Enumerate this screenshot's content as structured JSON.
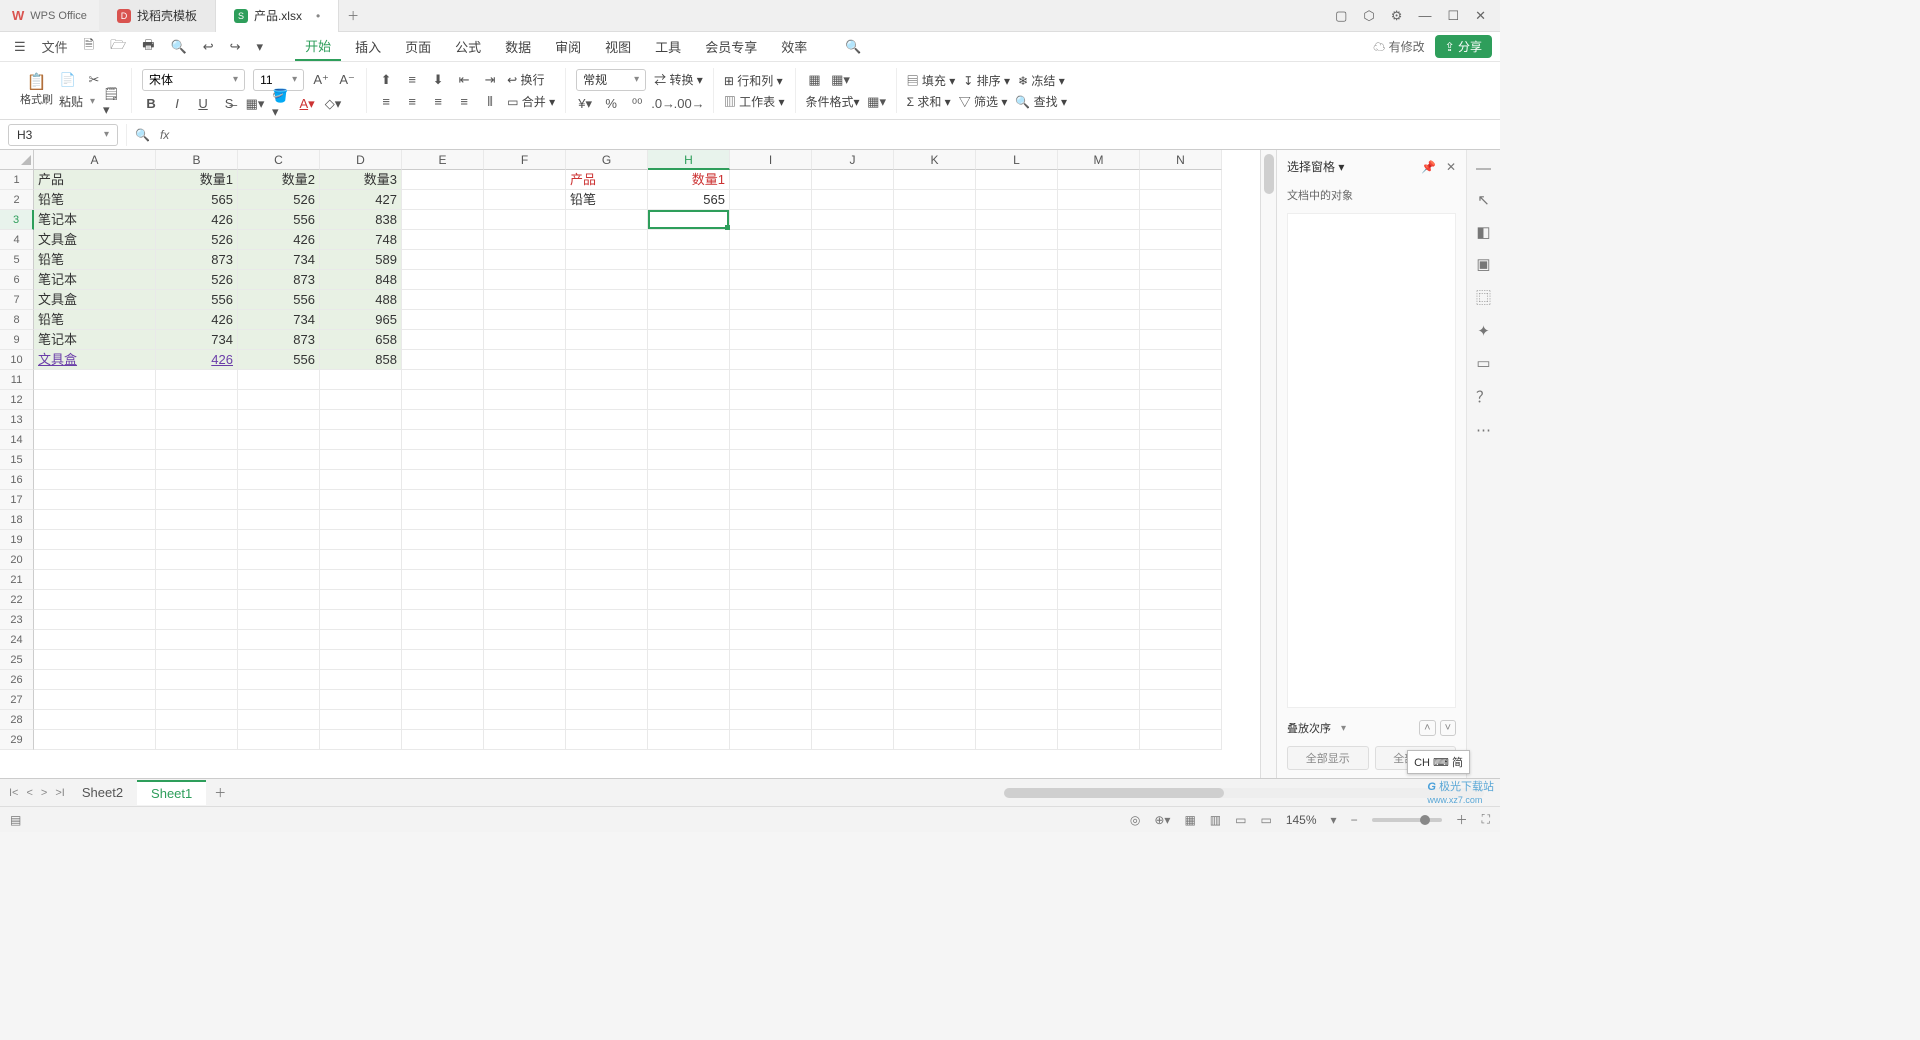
{
  "title": {
    "app": "WPS Office"
  },
  "tabs": [
    {
      "icon": "red",
      "label": "找稻壳模板"
    },
    {
      "icon": "green",
      "label": "产品.xlsx",
      "active": true,
      "dirty": "•"
    }
  ],
  "window": {
    "min": "—",
    "max": "☐",
    "close": "✕",
    "extra1": "▢",
    "extra2": "⬡",
    "extra3": "⚙"
  },
  "filemenu": {
    "hamburger": "☰",
    "file": "文件"
  },
  "qat": [
    "↩",
    "↪",
    "⋯"
  ],
  "qat_icons": [
    "📄",
    "📂",
    "🖨",
    "🔍",
    "🔗"
  ],
  "menutabs": [
    "开始",
    "插入",
    "页面",
    "公式",
    "数据",
    "审阅",
    "视图",
    "工具",
    "会员专享",
    "效率"
  ],
  "menuright": {
    "cloud": "☁ 有修改",
    "share": "⇪ 分享"
  },
  "ribbon": {
    "clipboard": {
      "paste": "📋",
      "paste_lbl": "格式刷",
      "copy": "📋",
      "pastev": "粘贴",
      "cut": "✂",
      "dd": "▾"
    },
    "font": {
      "name": "宋体",
      "size": "11",
      "btns_row1": [
        "A⁺",
        "A⁻"
      ],
      "btns_row2": [
        "B",
        "I",
        "U",
        "S",
        "▦▾",
        "🪣▾",
        "A▾",
        "◇▾"
      ]
    },
    "align": {
      "row1": [
        "≡",
        "≡",
        "≡",
        "≡",
        "↕",
        "↔ 换行"
      ],
      "row2": [
        "≡",
        "≡",
        "≡",
        "≡",
        "⫴",
        "▭ 合并 ▾"
      ]
    },
    "number": {
      "row1": [
        "常规",
        "▾",
        "⇄ 转换 ▾"
      ],
      "row2": [
        "¥▾",
        "%",
        "⁰⁰",
        "⁺⁰",
        "⁻⁰"
      ]
    },
    "cells": {
      "row1": [
        "⊞ 行和列 ▾"
      ],
      "row2": [
        "▥ 工作表 ▾"
      ]
    },
    "styles": {
      "row1": [
        "▦",
        "▦▾"
      ],
      "row2": [
        "条件格式▾",
        "▦▾"
      ]
    },
    "editing": {
      "row1": [
        "▤ 填充 ▾",
        "↧ 排序 ▾",
        "❄ 冻结 ▾"
      ],
      "row2": [
        "Σ 求和 ▾",
        "▽ 筛选 ▾",
        "🔍 查找 ▾"
      ]
    }
  },
  "fbar": {
    "name": "H3",
    "fx": "fx",
    "search": "🔍",
    "input": ""
  },
  "cols": [
    "A",
    "B",
    "C",
    "D",
    "E",
    "F",
    "G",
    "H",
    "I",
    "J",
    "K",
    "L",
    "M",
    "N"
  ],
  "rows": 29,
  "sel": {
    "col": "H",
    "row": 3
  },
  "griddata": {
    "A1": "产品",
    "B1": "数量1",
    "C1": "数量2",
    "D1": "数量3",
    "A2": "铅笔",
    "B2": "565",
    "C2": "526",
    "D2": "427",
    "A3": "笔记本",
    "B3": "426",
    "C3": "556",
    "D3": "838",
    "A4": "文具盒",
    "B4": "526",
    "C4": "426",
    "D4": "748",
    "A5": "铅笔",
    "B5": "873",
    "C5": "734",
    "D5": "589",
    "A6": "笔记本",
    "B6": "526",
    "C6": "873",
    "D6": "848",
    "A7": "文具盒",
    "B7": "556",
    "C7": "556",
    "D7": "488",
    "A8": "铅笔",
    "B8": "426",
    "C8": "734",
    "D8": "965",
    "A9": "笔记本",
    "B9": "734",
    "C9": "873",
    "D9": "658",
    "A10": "文具盒",
    "B10": "426",
    "C10": "556",
    "D10": "858",
    "G1": "产品",
    "H1": "数量1",
    "G2": "铅笔",
    "H2": "565"
  },
  "sheets": {
    "list": [
      "Sheet2",
      "Sheet1"
    ],
    "active": "Sheet1"
  },
  "rpanel": {
    "title": "选择窗格",
    "sub": "文档中的对象",
    "order": "叠放次序",
    "show": "全部显示",
    "hide": "全部隐藏"
  },
  "status": {
    "zoom": "145%",
    "icons": [
      "⊞",
      "⿴",
      "▭",
      "▦",
      "⊟",
      "⊞"
    ]
  },
  "ime": {
    "label": "CH ⌨ 简"
  },
  "wm": {
    "brand": "极光下载站",
    "url": "www.xz7.com"
  }
}
